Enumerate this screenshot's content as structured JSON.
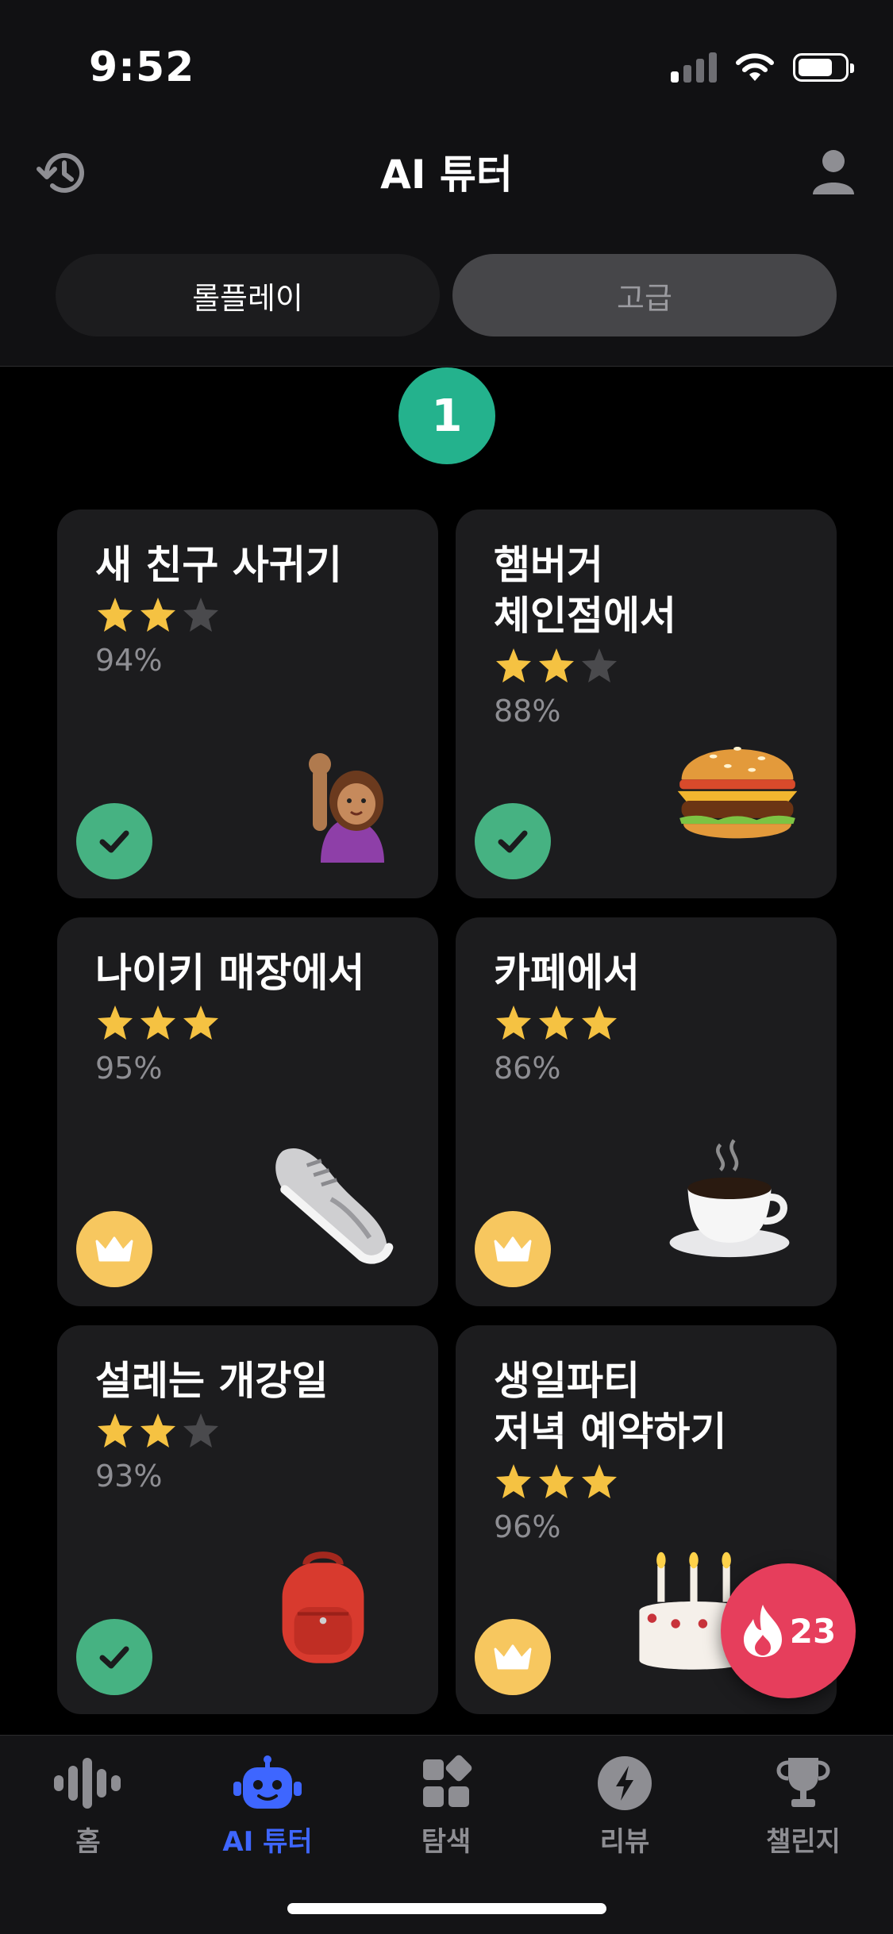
{
  "status": {
    "time": "9:52"
  },
  "header": {
    "title": "AI 튜터",
    "history_icon": "history-icon",
    "profile_icon": "profile-icon"
  },
  "segments": {
    "roleplay": "롤플레이",
    "advanced": "고급",
    "selected": "roleplay"
  },
  "level": {
    "number": "1"
  },
  "cards": [
    {
      "title": "새 친구 사귀기",
      "stars": 2,
      "percent": "94%",
      "status": "check",
      "icon": "person-raising-hand-emoji"
    },
    {
      "title": "햄버거\n체인점에서",
      "stars": 2,
      "percent": "88%",
      "status": "check",
      "icon": "hamburger-emoji"
    },
    {
      "title": "나이키 매장에서",
      "stars": 3,
      "percent": "95%",
      "status": "crown",
      "icon": "sneaker-emoji"
    },
    {
      "title": "카페에서",
      "stars": 3,
      "percent": "86%",
      "status": "crown",
      "icon": "coffee-emoji"
    },
    {
      "title": "설레는 개강일",
      "stars": 2,
      "percent": "93%",
      "status": "check",
      "icon": "backpack-emoji"
    },
    {
      "title": "생일파티\n저녁 예약하기",
      "stars": 3,
      "percent": "96%",
      "status": "crown",
      "icon": "birthday-cake-emoji"
    }
  ],
  "streak": {
    "count": "23",
    "icon": "flame-icon"
  },
  "tabs": [
    {
      "label": "홈",
      "icon": "waveform-icon",
      "active": false
    },
    {
      "label": "AI 튜터",
      "icon": "robot-icon",
      "active": true
    },
    {
      "label": "탐색",
      "icon": "grid-explore-icon",
      "active": false
    },
    {
      "label": "리뷰",
      "icon": "bolt-icon",
      "active": false
    },
    {
      "label": "챌린지",
      "icon": "trophy-icon",
      "active": false
    }
  ],
  "colors": {
    "accent": "#3e66ff",
    "check": "#46b282",
    "crown": "#f7c75f",
    "star": "#f5c242",
    "level": "#24b28d",
    "streak": "#e63e5c"
  }
}
